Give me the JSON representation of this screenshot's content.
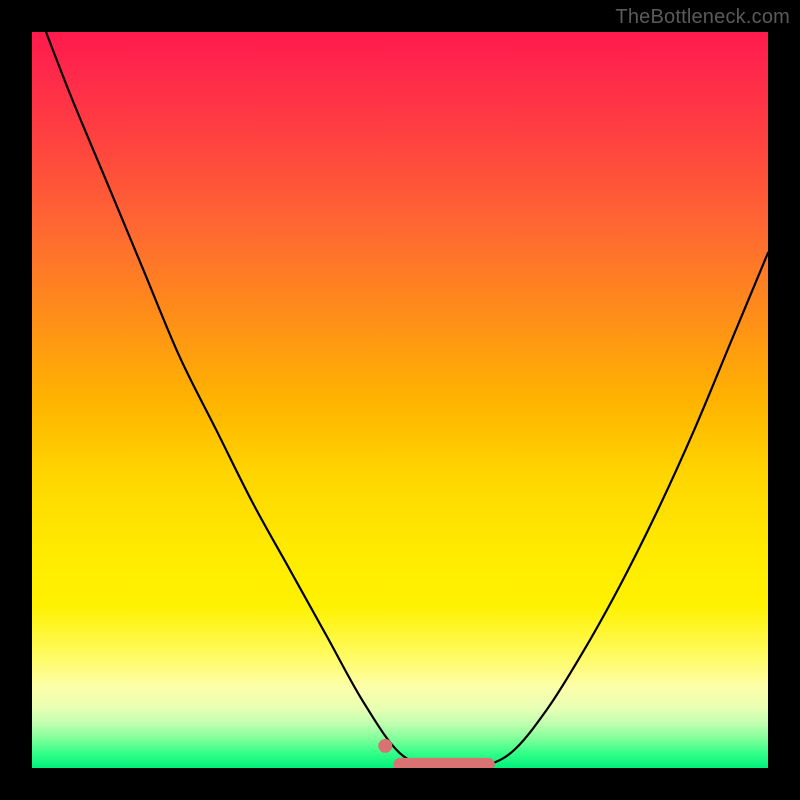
{
  "watermark": "TheBottleneck.com",
  "colors": {
    "page_bg": "#000000",
    "watermark": "#5a5a5a",
    "curve_stroke": "#000000",
    "marker_stroke": "#d97272",
    "marker_fill": "#d97272",
    "gradient_stops": [
      "#ff1a4d",
      "#ff2a4a",
      "#ff4040",
      "#ff6633",
      "#ff8c1a",
      "#ffb300",
      "#ffd500",
      "#ffea00",
      "#fff200",
      "#fffb66",
      "#fdffaa",
      "#e6ffb3",
      "#bfffb0",
      "#80ff9a",
      "#33ff88",
      "#00f07a"
    ]
  },
  "chart_data": {
    "type": "line",
    "title": "",
    "xlabel": "",
    "ylabel": "",
    "xlim": [
      0,
      100
    ],
    "ylim": [
      0,
      100
    ],
    "grid": false,
    "legend": false,
    "series": [
      {
        "name": "bottleneck-curve",
        "x": [
          0,
          5,
          10,
          15,
          20,
          25,
          30,
          35,
          40,
          45,
          50,
          55,
          60,
          65,
          70,
          75,
          80,
          85,
          90,
          95,
          100
        ],
        "values": [
          105,
          92,
          80,
          68,
          56,
          46,
          36,
          27,
          18,
          9,
          2,
          0,
          0,
          2,
          8,
          16,
          25,
          35,
          46,
          58,
          70
        ]
      }
    ],
    "markers": [
      {
        "name": "dot-left",
        "x": 48,
        "y": 3
      },
      {
        "name": "trough-band",
        "x_from": 50,
        "x_to": 62,
        "y": 0.5
      }
    ],
    "annotations": []
  }
}
